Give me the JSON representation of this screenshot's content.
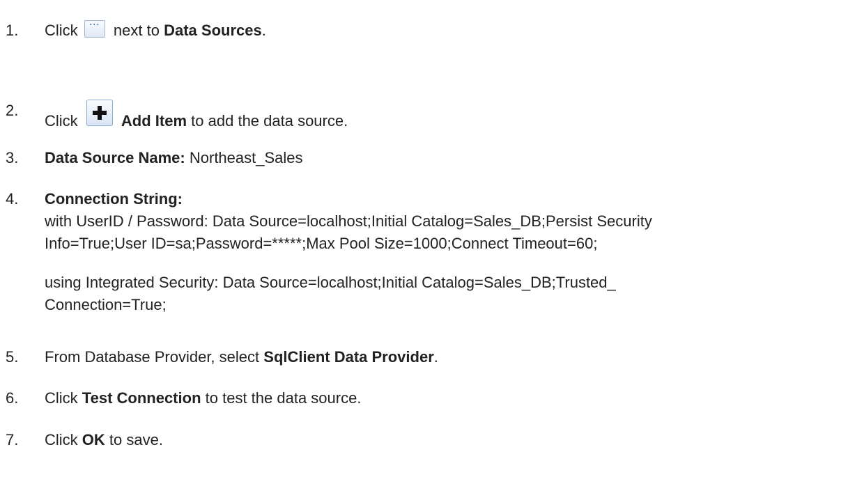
{
  "steps": [
    {
      "number": "1.",
      "text_before": "Click",
      "icon": "ellipsis-button-icon",
      "text_after": "next to",
      "bold": "Data Sources",
      "end": "."
    },
    {
      "number": "2.",
      "text_before": "Click",
      "icon": "add-item-icon",
      "bold": "Add Item",
      "text_after": "to add the data source."
    },
    {
      "number": "3.",
      "bold": "Data Source Name:",
      "text_after": "Northeast_Sales"
    },
    {
      "number": "4.",
      "bold": "Connection String:",
      "line1": "with UserID / Password: Data Source=localhost;Initial Catalog=Sales_DB;Persist Security",
      "line2": "Info=True;User ID=sa;Password=*****;Max Pool Size=1000;Connect Timeout=60;",
      "line3": "using Integrated Security: Data Source=localhost;Initial Catalog=Sales_DB;Trusted_",
      "line4": "Connection=True;"
    },
    {
      "number": "5.",
      "text_before": "From Database Provider, select",
      "bold": "SqlClient Data Provider",
      "end": "."
    },
    {
      "number": "6.",
      "text_before": "Click",
      "bold": "Test Connection",
      "text_after": "to test the data source."
    },
    {
      "number": "7.",
      "text_before": "Click",
      "bold": "OK",
      "text_after": "to save."
    }
  ],
  "colors": {
    "text": "#222222",
    "icon_border": "#9fb4cf",
    "icon_fill": "#dfe9f6",
    "plus_color": "#111111"
  }
}
